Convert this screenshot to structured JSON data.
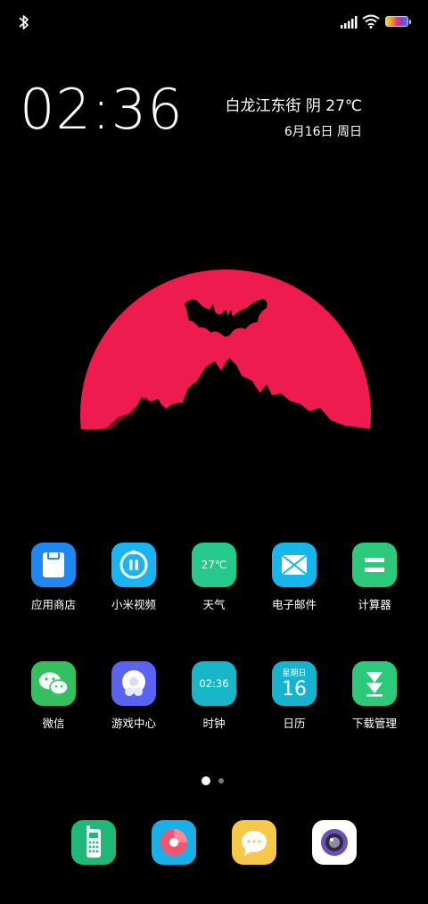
{
  "status_bar": {
    "bluetooth_icon": "bluetooth-icon",
    "signal_icon": "signal-icon",
    "wifi_icon": "wifi-icon",
    "battery_icon": "battery-icon"
  },
  "clock": {
    "time": "02:36"
  },
  "weather": {
    "text": "白龙江东街 阴 27℃"
  },
  "date": {
    "text": "6月16日 周日"
  },
  "wallpaper": {
    "moon_color": "#ee1c4e",
    "icon": "bat-moon-illustration"
  },
  "apps": {
    "row1": [
      {
        "label": "应用商店",
        "color": "#1e88f0"
      },
      {
        "label": "小米视频",
        "color": "#1ab4f0"
      },
      {
        "label": "天气",
        "color": "#26c98c",
        "icon_text": "27℃"
      },
      {
        "label": "电子邮件",
        "color": "#17b6ea"
      },
      {
        "label": "计算器",
        "color": "#2cc97a"
      }
    ],
    "row2": [
      {
        "label": "微信",
        "color": "#35c05f"
      },
      {
        "label": "游戏中心",
        "color": "#5b63f2"
      },
      {
        "label": "时钟",
        "color": "#18b6c8",
        "icon_text": "02:36"
      },
      {
        "label": "日历",
        "color": "#16b3cf",
        "icon_weekday": "星期日",
        "icon_day": "16"
      },
      {
        "label": "下载管理",
        "color": "#2cc97a"
      }
    ]
  },
  "page_indicator": {
    "current": 1,
    "total": 2
  },
  "dock": [
    {
      "name": "phone",
      "color": "#20b878"
    },
    {
      "name": "music",
      "color": "#1ab0e6"
    },
    {
      "name": "messages",
      "color": "#f5c84a"
    },
    {
      "name": "camera",
      "color": "#ffffff"
    }
  ]
}
